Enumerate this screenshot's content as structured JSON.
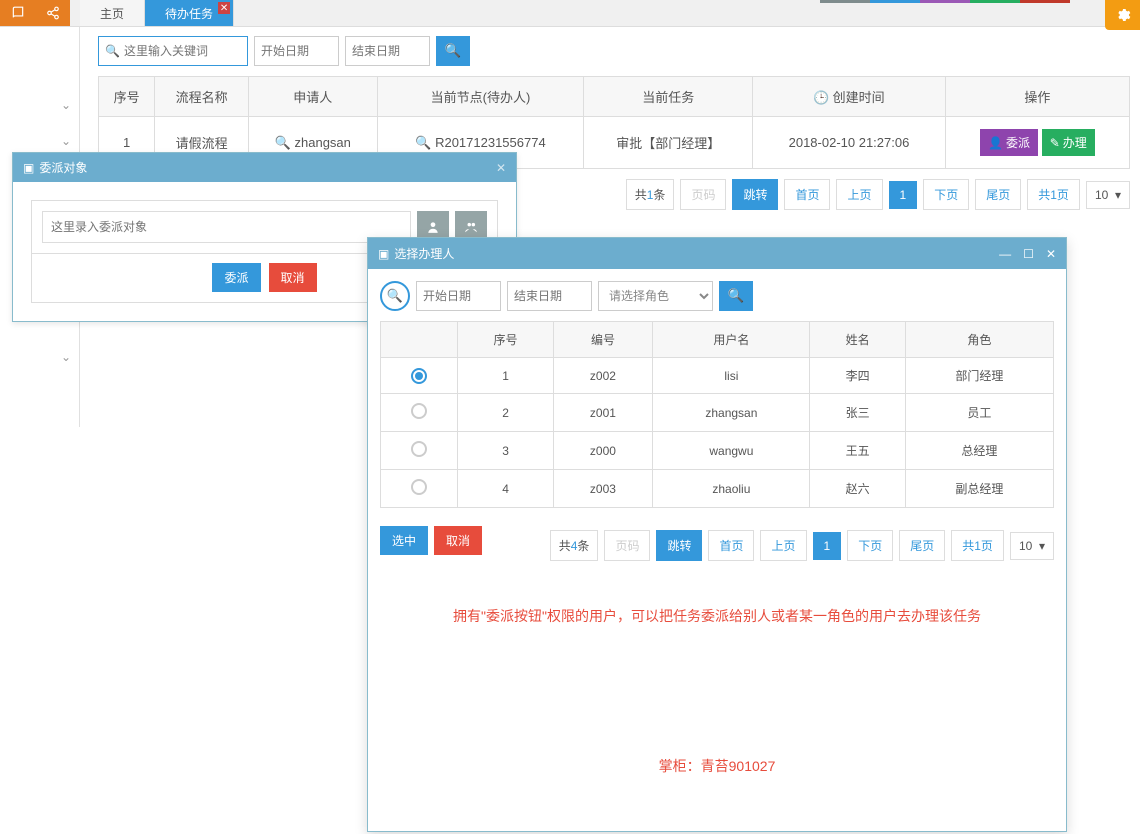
{
  "topbar": {
    "tab_home": "主页",
    "tab_tasks": "待办任务"
  },
  "search": {
    "keyword_placeholder": "这里输入关键词",
    "start_date_placeholder": "开始日期",
    "end_date_placeholder": "结束日期"
  },
  "task_table": {
    "headers": {
      "seq": "序号",
      "name": "流程名称",
      "applicant": "申请人",
      "node": "当前节点(待办人)",
      "task": "当前任务",
      "created": "创建时间",
      "ops": "操作"
    },
    "rows": [
      {
        "seq": "1",
        "name": "请假流程",
        "applicant": "zhangsan",
        "node": "R20171231556774",
        "task": "审批【部门经理】",
        "created": "2018-02-10 21:27:06"
      }
    ],
    "btn_delegate": "委派",
    "btn_handle": "办理"
  },
  "pagination_main": {
    "total_prefix": "共",
    "total_count": "1",
    "total_suffix": "条",
    "page_placeholder": "页码",
    "jump": "跳转",
    "first": "首页",
    "prev": "上页",
    "current": "1",
    "next": "下页",
    "last": "尾页",
    "pages_prefix": "共",
    "pages_count": "1",
    "pages_suffix": "页",
    "size": "10"
  },
  "modal1": {
    "title": "委派对象",
    "input_placeholder": "这里录入委派对象",
    "btn_delegate": "委派",
    "btn_cancel": "取消"
  },
  "modal2": {
    "title": "选择办理人",
    "start_date_placeholder": "开始日期",
    "end_date_placeholder": "结束日期",
    "role_placeholder": "请选择角色",
    "user_table": {
      "headers": {
        "seq": "序号",
        "code": "编号",
        "username": "用户名",
        "name": "姓名",
        "role": "角色"
      },
      "rows": [
        {
          "seq": "1",
          "code": "z002",
          "username": "lisi",
          "name": "李四",
          "role": "部门经理",
          "selected": true
        },
        {
          "seq": "2",
          "code": "z001",
          "username": "zhangsan",
          "name": "张三",
          "role": "员工",
          "selected": false
        },
        {
          "seq": "3",
          "code": "z000",
          "username": "wangwu",
          "name": "王五",
          "role": "总经理",
          "selected": false
        },
        {
          "seq": "4",
          "code": "z003",
          "username": "zhaoliu",
          "name": "赵六",
          "role": "副总经理",
          "selected": false
        }
      ]
    },
    "btn_select": "选中",
    "btn_cancel": "取消",
    "pagination": {
      "total_prefix": "共",
      "total_count": "4",
      "total_suffix": "条",
      "page_placeholder": "页码",
      "jump": "跳转",
      "first": "首页",
      "prev": "上页",
      "current": "1",
      "next": "下页",
      "last": "尾页",
      "pages_prefix": "共",
      "pages_count": "1",
      "pages_suffix": "页",
      "size": "10"
    },
    "note": "拥有\"委派按钮\"权限的用户，可以把任务委派给别人或者某一角色的用户去办理该任务",
    "author": "掌柜：青苔901027"
  }
}
